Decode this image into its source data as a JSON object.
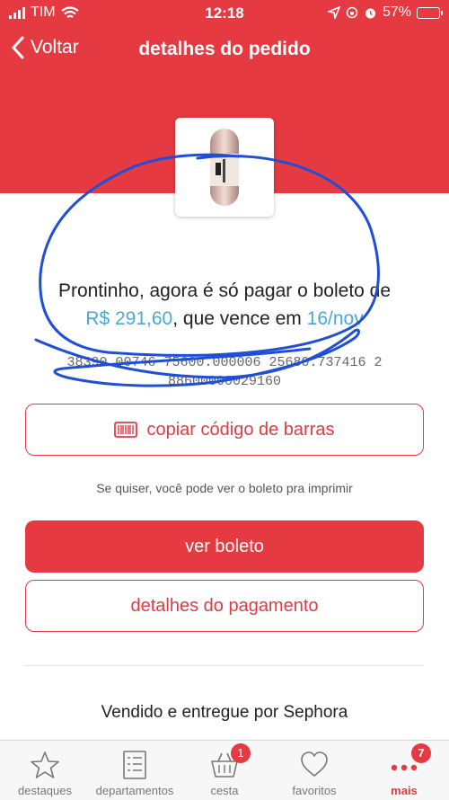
{
  "status_bar": {
    "carrier": "TIM",
    "time": "12:18",
    "battery": "57%"
  },
  "nav": {
    "back_label": "Voltar",
    "title": "detalhes do pedido"
  },
  "order": {
    "message_before": "Prontinho, agora é só pagar o boleto de",
    "amount": "R$ 291,60",
    "message_middle": ", que vence em ",
    "due_date": "16/nov",
    "barcode_line1": "38390.00746 75600.000006 25680.737416 2",
    "barcode_line2": "88600000029160"
  },
  "actions": {
    "copy_barcode": "copiar código de barras",
    "hint": "Se quiser, você pode ver o boleto pra imprimir",
    "view_boleto": "ver boleto",
    "payment_details": "detalhes do pagamento"
  },
  "seller": "Vendido e entregue por Sephora",
  "tabbar": {
    "items": [
      {
        "label": "destaques",
        "icon": "star-icon"
      },
      {
        "label": "departamentos",
        "icon": "list-icon"
      },
      {
        "label": "cesta",
        "icon": "basket-icon",
        "badge": "1"
      },
      {
        "label": "favoritos",
        "icon": "heart-icon"
      },
      {
        "label": "mais",
        "icon": "more-icon",
        "badge": "7",
        "active": true
      }
    ]
  },
  "colors": {
    "brand_red": "#e53a41",
    "accent_blue": "#4aa8d8",
    "scribble_blue": "#1f4fd6"
  }
}
